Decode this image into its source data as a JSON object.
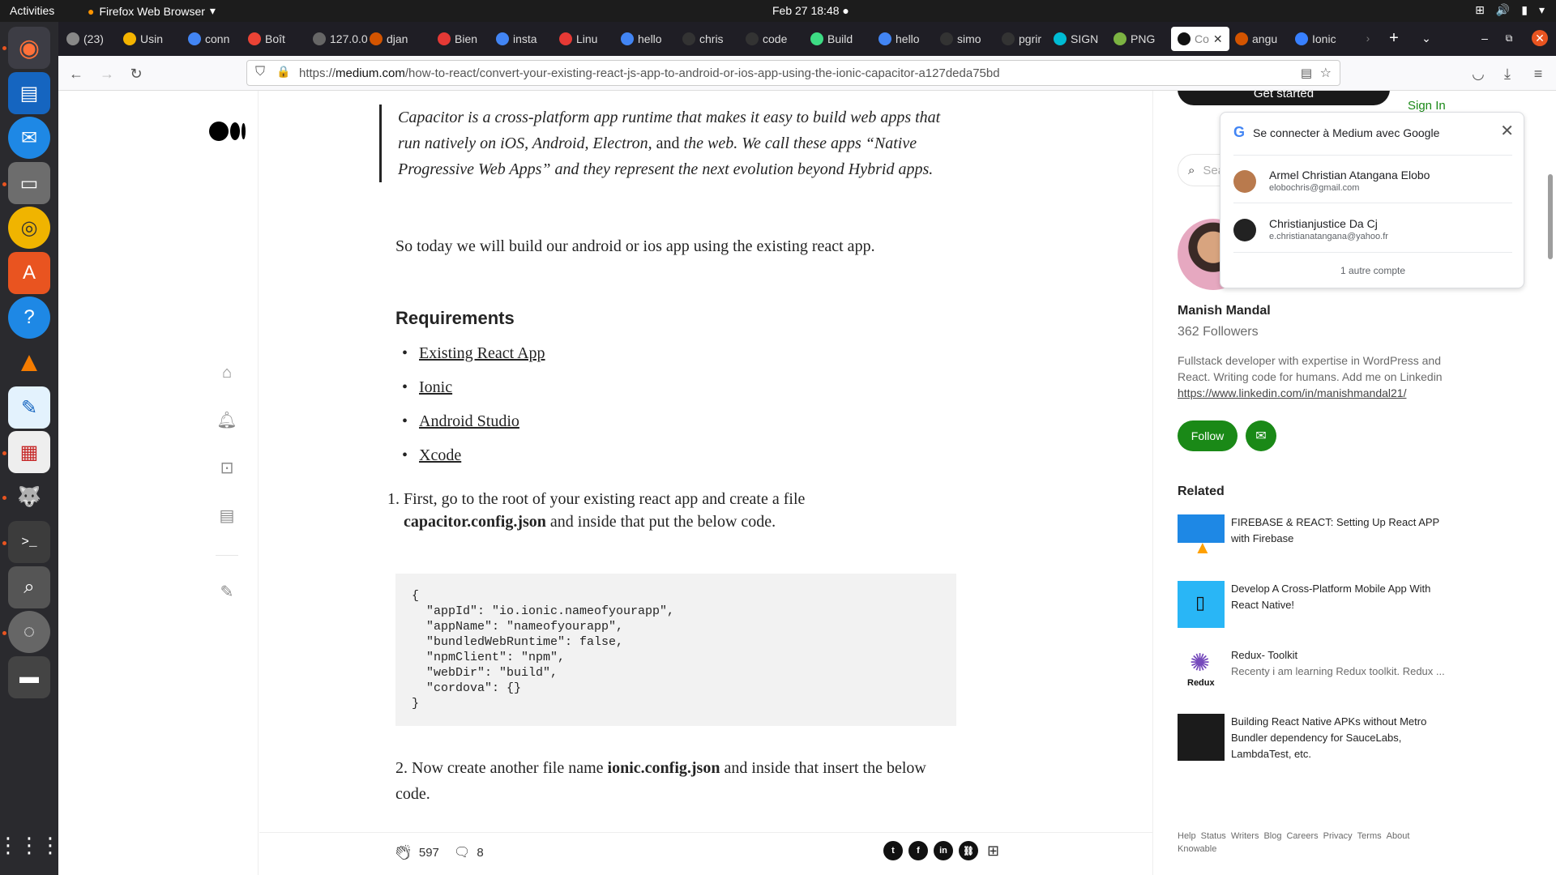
{
  "topbar": {
    "activities": "Activities",
    "app_name": "Firefox Web Browser",
    "clock": "Feb 27  18:48"
  },
  "tabs": [
    {
      "label": "(23)",
      "color": "#888"
    },
    {
      "label": "Usin",
      "color": "#f4b400"
    },
    {
      "label": "conn",
      "color": "#4285f4"
    },
    {
      "label": "Boît",
      "color": "#ea4335"
    },
    {
      "label": "127.0.0",
      "color": "#666"
    },
    {
      "label": "djan",
      "color": "#d35400"
    },
    {
      "label": "Bien",
      "color": "#e53935"
    },
    {
      "label": "insta",
      "color": "#4285f4"
    },
    {
      "label": "Linu",
      "color": "#e53935"
    },
    {
      "label": "hello",
      "color": "#4285f4"
    },
    {
      "label": "chris",
      "color": "#333"
    },
    {
      "label": "code",
      "color": "#333"
    },
    {
      "label": "Build",
      "color": "#3ddc84"
    },
    {
      "label": "hello",
      "color": "#4285f4"
    },
    {
      "label": "simo",
      "color": "#333"
    },
    {
      "label": "pgrir",
      "color": "#333"
    },
    {
      "label": "SIGN",
      "color": "#00bcd4"
    },
    {
      "label": "PNG",
      "color": "#7cb342"
    },
    {
      "label": "Co",
      "color": "#111",
      "active": true
    },
    {
      "label": "angu",
      "color": "#d35400"
    },
    {
      "label": "Ionic",
      "color": "#3880ff"
    }
  ],
  "url": {
    "prefix": "https://",
    "host": "medium.com",
    "path": "/how-to-react/convert-your-existing-react-js-app-to-android-or-ios-app-using-the-ionic-capacitor-a127deda75bd"
  },
  "article": {
    "quote_parts": [
      "Capacitor is a cross-platform app runtime that makes it easy to build web apps that run natively on iOS, Android, Electron, ",
      "and",
      " the web. We call these apps “Native Progressive Web Apps” and they represent the next evolution beyond Hybrid apps."
    ],
    "intro": "So today we will build our android or ios app using the existing react app.",
    "requirements_heading": "Requirements",
    "requirements": [
      "Existing React App",
      "Ionic",
      "Android Studio",
      "Xcode"
    ],
    "step1_num": "1.",
    "step1_a": "First, go to the root of your existing react app and create a file",
    "step1_file": "capacitor.config.json",
    "step1_b": " and inside that put the below code.",
    "code": "{\n  \"appId\": \"io.ionic.nameofyourapp\",\n  \"appName\": \"nameofyourapp\",\n  \"bundledWebRuntime\": false,\n  \"npmClient\": \"npm\",\n  \"webDir\": \"build\",\n  \"cordova\": {}\n}",
    "step2_a": "2. Now create another file name ",
    "step2_file": "ionic.config.json",
    "step2_b": " and inside that insert the below code."
  },
  "footer_bar": {
    "claps": "597",
    "responses": "8"
  },
  "sidebar": {
    "get_started": "Get started",
    "sign_in": "Sign In",
    "search_placeholder": "Search",
    "author_name": "Manish Mandal",
    "followers": "362 Followers",
    "bio": "Fullstack developer with expertise in WordPress and React. Writing code for humans. Add me on Linkedin",
    "bio_link": "https://www.linkedin.com/in/manishmandal21/",
    "follow": "Follow",
    "related_heading": "Related",
    "related": [
      {
        "title": "FIREBASE & REACT: Setting Up React APP with Firebase",
        "sub": "",
        "thumb": "#1e88e5"
      },
      {
        "title": "Develop A Cross-Platform Mobile App With React Native!",
        "sub": "",
        "thumb": "#29b6f6"
      },
      {
        "title": "Redux- Toolkit",
        "sub": "Recenty i am learning Redux toolkit. Redux ...",
        "thumb": "#ffffff"
      },
      {
        "title": "Building React Native APKs without Metro Bundler dependency for SauceLabs, LambdaTest, etc.",
        "sub": "",
        "thumb": "#1b1b1b"
      }
    ],
    "footer_links": [
      "Help",
      "Status",
      "Writers",
      "Blog",
      "Careers",
      "Privacy",
      "Terms",
      "About",
      "Knowable"
    ]
  },
  "google_popup": {
    "title": "Se connecter à Medium avec Google",
    "accounts": [
      {
        "name": "Armel Christian Atangana Elobo",
        "email": "elobochris@gmail.com"
      },
      {
        "name": "Christianjustice Da Cj",
        "email": "e.christianatangana@yahoo.fr"
      }
    ],
    "more": "1 autre compte"
  },
  "colors": {
    "medium_green": "#1a8917",
    "ubuntu_orange": "#e95420"
  }
}
